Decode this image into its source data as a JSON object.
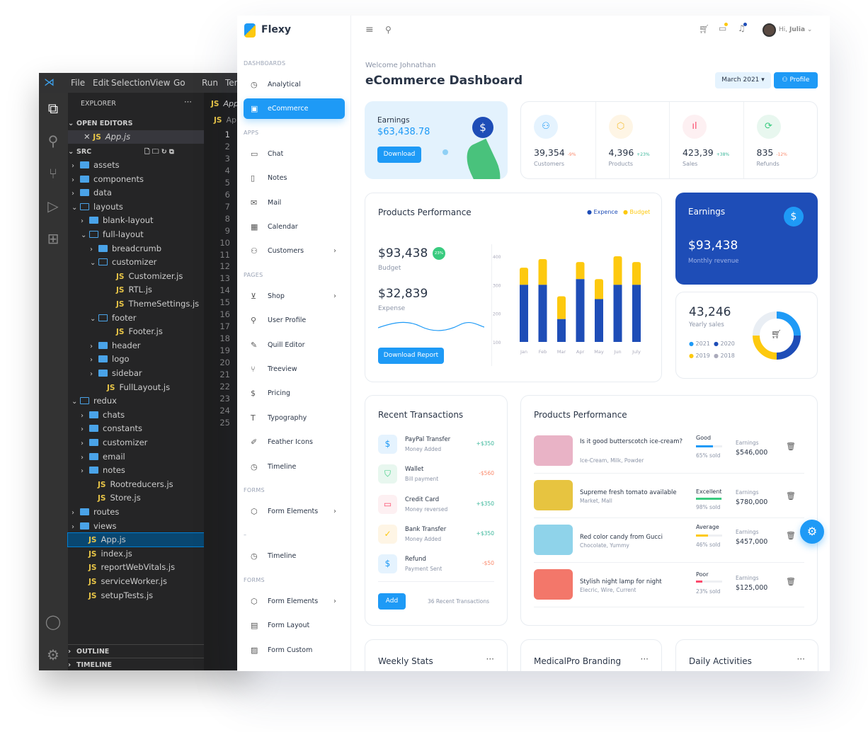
{
  "vscode": {
    "menu": [
      "File",
      "Edit",
      "Selection",
      "View",
      "Go",
      "Run",
      "Ter"
    ],
    "explorer_title": "EXPLORER",
    "open_editors": "OPEN EDITORS",
    "open_file": "App.js",
    "src": "SRC",
    "outline": "OUTLINE",
    "timeline": "TIMELINE",
    "tab_label": "App",
    "breadcrumb": "Ap",
    "tree": [
      {
        "n": "assets",
        "d": 1,
        "t": "folder"
      },
      {
        "n": "components",
        "d": 1,
        "t": "folder"
      },
      {
        "n": "data",
        "d": 1,
        "t": "folder"
      },
      {
        "n": "layouts",
        "d": 1,
        "t": "open"
      },
      {
        "n": "blank-layout",
        "d": 2,
        "t": "folder"
      },
      {
        "n": "full-layout",
        "d": 2,
        "t": "open"
      },
      {
        "n": "breadcrumb",
        "d": 3,
        "t": "folder"
      },
      {
        "n": "customizer",
        "d": 3,
        "t": "open"
      },
      {
        "n": "Customizer.js",
        "d": 4,
        "t": "file"
      },
      {
        "n": "RTL.js",
        "d": 4,
        "t": "file"
      },
      {
        "n": "ThemeSettings.js",
        "d": 4,
        "t": "file"
      },
      {
        "n": "footer",
        "d": 3,
        "t": "open"
      },
      {
        "n": "Footer.js",
        "d": 4,
        "t": "file"
      },
      {
        "n": "header",
        "d": 3,
        "t": "folder"
      },
      {
        "n": "logo",
        "d": 3,
        "t": "folder"
      },
      {
        "n": "sidebar",
        "d": 3,
        "t": "folder"
      },
      {
        "n": "FullLayout.js",
        "d": 3,
        "t": "file"
      },
      {
        "n": "redux",
        "d": 1,
        "t": "open"
      },
      {
        "n": "chats",
        "d": 2,
        "t": "folder"
      },
      {
        "n": "constants",
        "d": 2,
        "t": "folder"
      },
      {
        "n": "customizer",
        "d": 2,
        "t": "folder"
      },
      {
        "n": "email",
        "d": 2,
        "t": "folder"
      },
      {
        "n": "notes",
        "d": 2,
        "t": "folder"
      },
      {
        "n": "Rootreducers.js",
        "d": 2,
        "t": "file"
      },
      {
        "n": "Store.js",
        "d": 2,
        "t": "file"
      },
      {
        "n": "routes",
        "d": 1,
        "t": "folder"
      },
      {
        "n": "views",
        "d": 1,
        "t": "folder"
      },
      {
        "n": "App.js",
        "d": 1,
        "t": "file",
        "sel": true
      },
      {
        "n": "index.js",
        "d": 1,
        "t": "file"
      },
      {
        "n": "reportWebVitals.js",
        "d": 1,
        "t": "file"
      },
      {
        "n": "serviceWorker.js",
        "d": 1,
        "t": "file"
      },
      {
        "n": "setupTests.js",
        "d": 1,
        "t": "file"
      }
    ],
    "line_count": 25
  },
  "app": {
    "name": "Flexy",
    "greeting": "Hi,",
    "user": "Julia"
  },
  "sidebar": [
    {
      "section": "DASHBOARDS"
    },
    {
      "label": "Analytical",
      "icon": "◷"
    },
    {
      "label": "eCommerce",
      "icon": "▣",
      "active": true
    },
    {
      "section": "APPS"
    },
    {
      "label": "Chat",
      "icon": "▭"
    },
    {
      "label": "Notes",
      "icon": "▯"
    },
    {
      "label": "Mail",
      "icon": "✉"
    },
    {
      "label": "Calendar",
      "icon": "▦"
    },
    {
      "label": "Customers",
      "icon": "⚇",
      "chev": true
    },
    {
      "section": "PAGES"
    },
    {
      "label": "Shop",
      "icon": "⊻",
      "chev": true
    },
    {
      "label": "User Profile",
      "icon": "⚲"
    },
    {
      "label": "Quill Editor",
      "icon": "✎"
    },
    {
      "label": "Treeview",
      "icon": "⑂"
    },
    {
      "label": "Pricing",
      "icon": "$"
    },
    {
      "label": "Typography",
      "icon": "T"
    },
    {
      "label": "Feather Icons",
      "icon": "✐"
    },
    {
      "label": "Timeline",
      "icon": "◷"
    },
    {
      "section": "FORMS"
    },
    {
      "label": "Form Elements",
      "icon": "⬡",
      "chev": true
    },
    {
      "section": "–"
    },
    {
      "label": "Timeline",
      "icon": "◷"
    },
    {
      "section": "FORMS"
    },
    {
      "label": "Form Elements",
      "icon": "⬡",
      "chev": true
    },
    {
      "label": "Form Layout",
      "icon": "▤"
    },
    {
      "label": "Form Custom",
      "icon": "▨"
    }
  ],
  "header": {
    "welcome": "Welcome Johnathan",
    "title": "eCommerce Dashboard",
    "month": "March 2021",
    "profile": "Profile"
  },
  "earnings_card": {
    "label": "Earnings",
    "value": "$63,438.78",
    "button": "Download"
  },
  "stats": [
    {
      "value": "39,354",
      "change": "-9%",
      "label": "Customers",
      "icon": "⚇",
      "color": "#1e9af6",
      "bg": "#e5f3fe",
      "up": false
    },
    {
      "value": "4,396",
      "change": "+23%",
      "label": "Products",
      "icon": "⬡",
      "color": "#f6c343",
      "bg": "#fef5e5",
      "up": true
    },
    {
      "value": "423,39",
      "change": "+38%",
      "label": "Sales",
      "icon": "ıl",
      "color": "#fc4b6c",
      "bg": "#fdf0f2",
      "up": true
    },
    {
      "value": "835",
      "change": "-12%",
      "label": "Refunds",
      "icon": "⟳",
      "color": "#39cb7f",
      "bg": "#e8f7ef",
      "up": false
    }
  ],
  "products_performance": {
    "title": "Products Performance",
    "legend": [
      "Expence",
      "Budget"
    ],
    "budget_value": "$93,438",
    "badge": "23%",
    "budget_label": "Budget",
    "expense_value": "$32,839",
    "expense_label": "Expense",
    "button": "Download Report",
    "colors": {
      "expence": "#1e4db7",
      "budget": "#fdc90f"
    }
  },
  "chart_data": {
    "type": "bar",
    "stacked": true,
    "categories": [
      "Jan",
      "Feb",
      "Mar",
      "Apr",
      "May",
      "Jun",
      "July"
    ],
    "series": [
      {
        "name": "Expence",
        "values": [
          300,
          300,
          180,
          320,
          250,
          300,
          300
        ]
      },
      {
        "name": "Budget",
        "values": [
          60,
          90,
          80,
          60,
          70,
          100,
          80
        ]
      }
    ],
    "yticks": [
      100,
      200,
      300,
      400
    ],
    "ylim": [
      100,
      400
    ]
  },
  "earnings_blue": {
    "label": "Earnings",
    "value": "$93,438",
    "sub": "Monthly revenue"
  },
  "yearly": {
    "value": "43,246",
    "label": "Yearly sales",
    "legend": [
      {
        "name": "2021",
        "color": "#1e9af6",
        "value": 25
      },
      {
        "name": "2020",
        "color": "#1e4db7",
        "value": 25
      },
      {
        "name": "2019",
        "color": "#fdc90f",
        "value": 25
      },
      {
        "name": "2018",
        "color": "#e9eef4",
        "value": 25
      }
    ]
  },
  "transactions": {
    "title": "Recent Transactions",
    "add": "Add",
    "count": "36 Recent Transactions",
    "items": [
      {
        "title": "PayPal Transfer",
        "sub": "Money Added",
        "amount": "+$350",
        "icon": "$",
        "color": "#1e9af6",
        "bg": "#e5f3fe",
        "up": true
      },
      {
        "title": "Wallet",
        "sub": "Bill payment",
        "amount": "-$560",
        "icon": "⛉",
        "color": "#39cb7f",
        "bg": "#e8f7ef",
        "up": false
      },
      {
        "title": "Credit Card",
        "sub": "Money reversed",
        "amount": "+$350",
        "icon": "▭",
        "color": "#fc4b6c",
        "bg": "#fdf0f2",
        "up": true
      },
      {
        "title": "Bank Transfer",
        "sub": "Money Added",
        "amount": "+$350",
        "icon": "✓",
        "color": "#fdc90f",
        "bg": "#fef5e5",
        "up": true
      },
      {
        "title": "Refund",
        "sub": "Payment Sent",
        "amount": "-$50",
        "icon": "$",
        "color": "#1e9af6",
        "bg": "#e5f3fe",
        "up": false
      }
    ]
  },
  "products_table": {
    "title": "Products Performance",
    "earnings_label": "Earnings",
    "items": [
      {
        "title": "Is it good butterscotch ice-cream?",
        "tags": "Ice-Cream, Milk, Powder",
        "rating": "Good",
        "sold": "65% sold",
        "pct": 65,
        "bar": "#1e9af6",
        "earn": "$546,000",
        "img": "#e9b3c6"
      },
      {
        "title": "Supreme fresh tomato available",
        "tags": "Market, Mall",
        "rating": "Excellent",
        "sold": "98% sold",
        "pct": 98,
        "bar": "#39cb7f",
        "earn": "$780,000",
        "img": "#e7c440"
      },
      {
        "title": "Red color candy from Gucci",
        "tags": "Chocolate, Yummy",
        "rating": "Average",
        "sold": "46% sold",
        "pct": 46,
        "bar": "#fdc90f",
        "earn": "$457,000",
        "img": "#8fd3ea"
      },
      {
        "title": "Stylish night lamp for night",
        "tags": "Elecric, Wire, Current",
        "rating": "Poor",
        "sold": "23% sold",
        "pct": 23,
        "bar": "#fc4b6c",
        "earn": "$125,000",
        "img": "#f3776a"
      }
    ]
  },
  "bottom_cards": [
    "Weekly Stats",
    "MedicalPro Branding",
    "Daily Activities"
  ]
}
